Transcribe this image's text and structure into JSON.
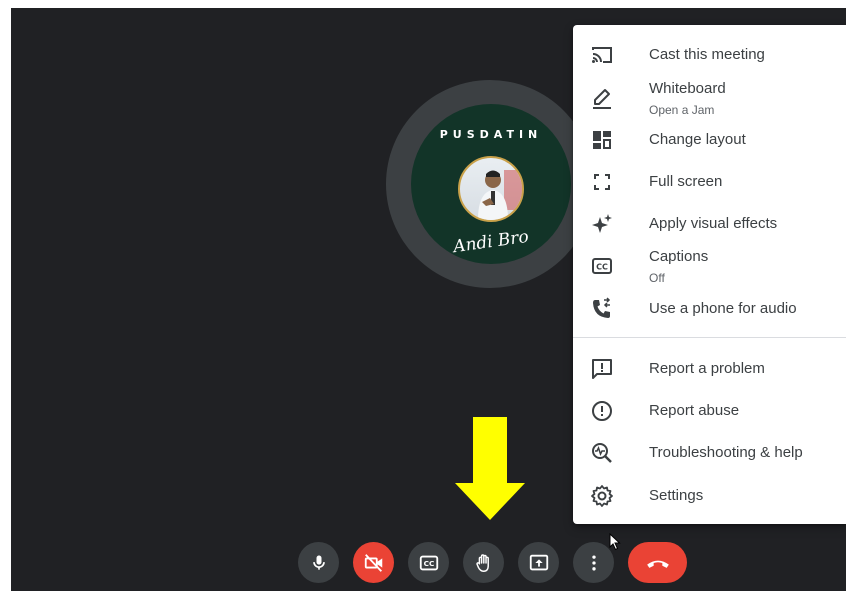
{
  "participant": {
    "name_banner": "PUSDATIN",
    "signature": "Andi Bro"
  },
  "controls": {
    "microphone": "microphone-icon",
    "camera_off": "camera-off-icon",
    "captions": "captions-icon",
    "raise_hand": "raise-hand-icon",
    "present": "present-screen-icon",
    "more": "more-options-icon",
    "end_call": "end-call-icon"
  },
  "menu": {
    "items": [
      {
        "label": "Cast this meeting",
        "icon": "cast-icon"
      },
      {
        "label": "Whiteboard",
        "sublabel": "Open a Jam",
        "icon": "pencil-icon"
      },
      {
        "label": "Change layout",
        "icon": "layout-icon"
      },
      {
        "label": "Full screen",
        "icon": "fullscreen-icon"
      },
      {
        "label": "Apply visual effects",
        "icon": "sparkle-icon"
      },
      {
        "label": "Captions",
        "sublabel": "Off",
        "icon": "captions-icon"
      },
      {
        "label": "Use a phone for audio",
        "icon": "phone-icon"
      },
      {
        "label": "Report a problem",
        "icon": "feedback-icon"
      },
      {
        "label": "Report abuse",
        "icon": "report-icon"
      },
      {
        "label": "Troubleshooting & help",
        "icon": "troubleshoot-icon"
      },
      {
        "label": "Settings",
        "icon": "settings-icon"
      }
    ]
  },
  "colors": {
    "background": "#202124",
    "control": "#3c4043",
    "danger": "#ea4335",
    "arrow": "#ffff00",
    "menu_text": "#3c4043"
  }
}
